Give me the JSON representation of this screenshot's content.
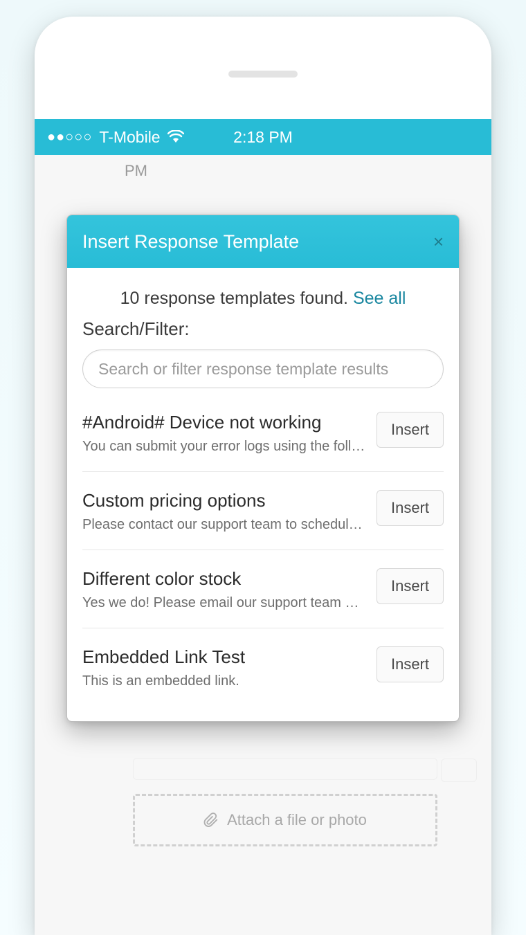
{
  "statusBar": {
    "signal": "●●○○○",
    "carrier": "T-Mobile",
    "time": "2:18 PM"
  },
  "peek": {
    "pm": "PM"
  },
  "attach": {
    "label": "Attach a file or photo"
  },
  "modal": {
    "title": "Insert Response Template",
    "closeGlyph": "×",
    "foundPrefix": "10 response templates found. ",
    "seeAll": "See all",
    "filterLabel": "Search/Filter:",
    "searchPlaceholder": "Search or filter response template results",
    "insertLabel": "Insert",
    "templates": [
      {
        "title": "#Android# Device not working",
        "desc": "You can submit your error logs using the foll…"
      },
      {
        "title": "Custom pricing options",
        "desc": "Please contact our support team to schedul…"
      },
      {
        "title": "Different color stock",
        "desc": "Yes we do! Please email our support team a…"
      },
      {
        "title": "Embedded Link Test",
        "desc": "This is an embedded link."
      }
    ]
  }
}
